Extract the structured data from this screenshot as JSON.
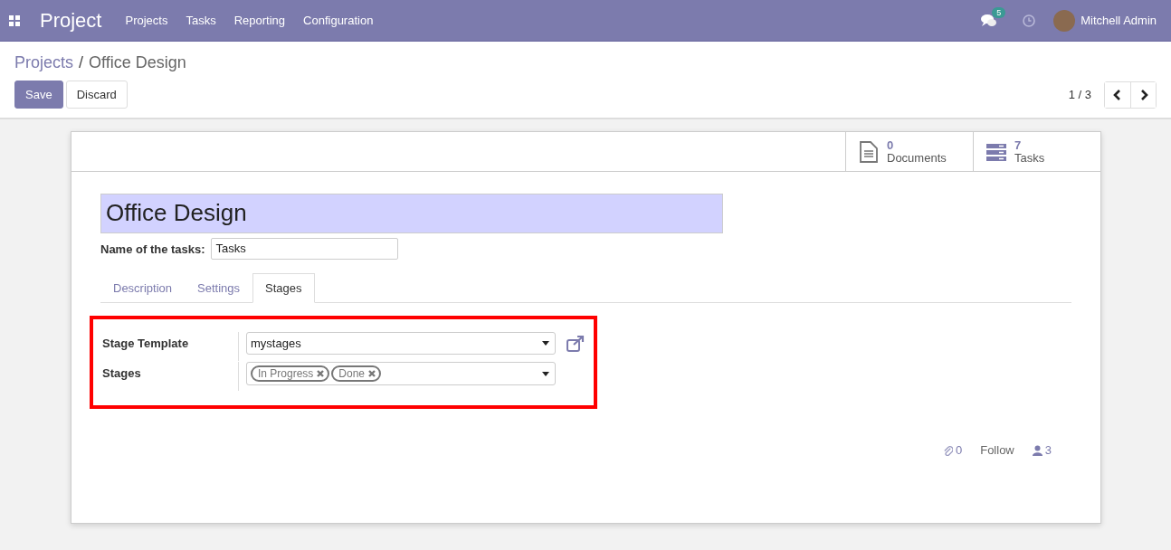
{
  "navbar": {
    "app_name": "Project",
    "menu": [
      "Projects",
      "Tasks",
      "Reporting",
      "Configuration"
    ],
    "messages_badge": "5",
    "user": "Mitchell Admin"
  },
  "breadcrumb": {
    "parent": "Projects",
    "separator": "/",
    "current": "Office Design"
  },
  "buttons": [
    {
      "label": "Save",
      "kind": "primary"
    },
    {
      "label": "Discard",
      "kind": "secondary"
    }
  ],
  "pager": {
    "value": "1 / 3"
  },
  "stat_buttons": [
    {
      "count": "0",
      "label": "Documents",
      "kind": "documents"
    },
    {
      "count": "7",
      "label": "Tasks",
      "kind": "tasks"
    }
  ],
  "title_field": {
    "value": "Office Design"
  },
  "task_name": {
    "label": "Name of the tasks:",
    "value": "Tasks"
  },
  "tabs": [
    {
      "label": "Description",
      "selected": false
    },
    {
      "label": "Settings",
      "selected": false
    },
    {
      "label": "Stages",
      "selected": true
    }
  ],
  "stages_section": {
    "highlighted": true,
    "fields": [
      {
        "label": "Stage Template",
        "kind": "select",
        "value": "mystages"
      },
      {
        "label": "Stages",
        "kind": "tags",
        "tags": [
          "In Progress",
          "Done"
        ]
      }
    ]
  },
  "chatter": {
    "attachments": "0",
    "follow": "Follow",
    "followers": "3"
  }
}
